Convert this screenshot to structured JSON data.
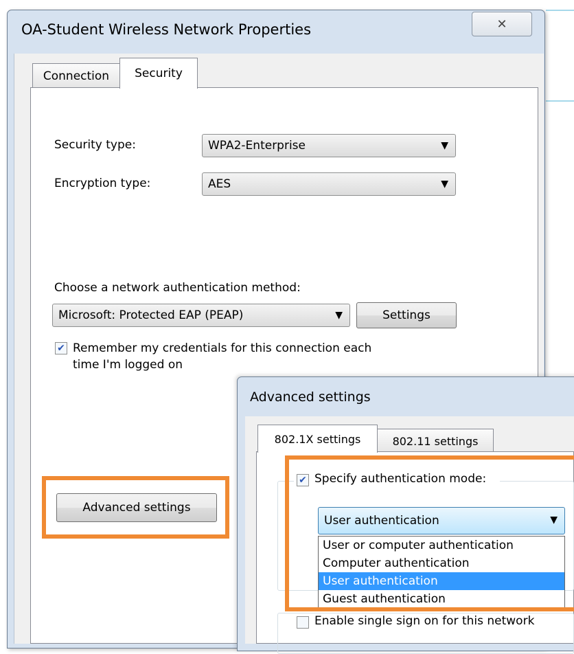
{
  "main_dialog": {
    "title": "OA-Student Wireless Network Properties",
    "close_symbol": "✕",
    "tabs": [
      "Connection",
      "Security"
    ],
    "security_type_label": "Security type:",
    "security_type_value": "WPA2-Enterprise",
    "encryption_type_label": "Encryption type:",
    "encryption_type_value": "AES",
    "auth_method_label": "Choose a network authentication method:",
    "auth_method_value": "Microsoft: Protected EAP (PEAP)",
    "settings_button": "Settings",
    "remember_checkbox_line1": "Remember my credentials for this connection each",
    "remember_checkbox_line2": "time I'm logged on",
    "remember_checked": true,
    "advanced_settings_button": "Advanced settings"
  },
  "advanced_dialog": {
    "title": "Advanced settings",
    "tabs": [
      "802.1X settings",
      "802.11 settings"
    ],
    "specify_auth_mode_label": "Specify authentication mode:",
    "specify_auth_mode_checked": true,
    "auth_mode_value": "User authentication",
    "auth_mode_options": [
      "User or computer authentication",
      "Computer authentication",
      "User authentication",
      "Guest authentication"
    ],
    "selected_option": "User authentication",
    "sso_label": "Enable single sign on for this network",
    "sso_checked": false
  },
  "icons": {
    "dropdown_arrow": "▼",
    "checkmark": "✔"
  },
  "colors": {
    "highlight": "#f08a33",
    "selection": "#3399ff",
    "window_frame": "#d6e2f0"
  }
}
